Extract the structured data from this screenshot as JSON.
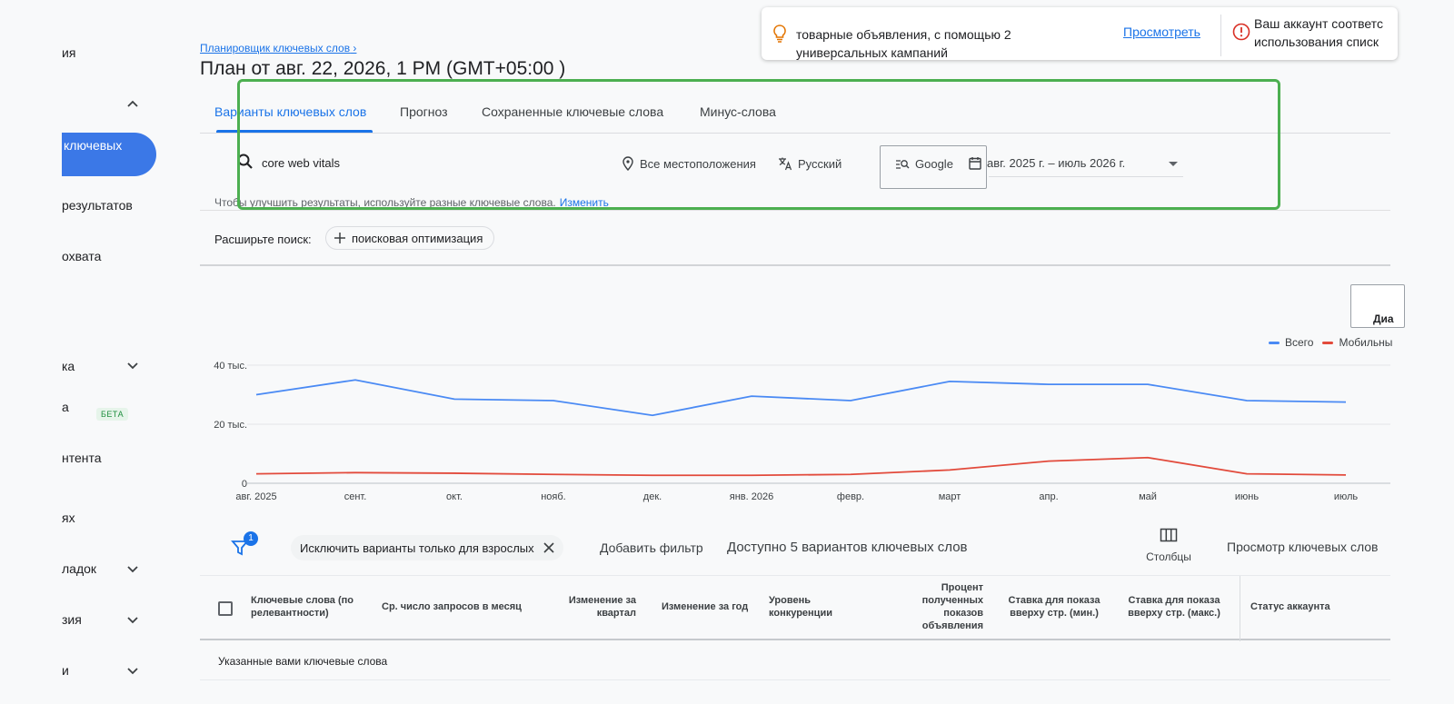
{
  "sidebar": {
    "items": [
      {
        "label": "ия"
      },
      {
        "label": "ключевых"
      },
      {
        "label": "результатов"
      },
      {
        "label": "охвата"
      },
      {
        "label": "ка"
      },
      {
        "label": "а"
      },
      {
        "label": "нтента"
      },
      {
        "label": "ях"
      },
      {
        "label": "ладок"
      },
      {
        "label": "зия"
      },
      {
        "label": "и"
      }
    ],
    "beta_label": "БЕТА"
  },
  "header": {
    "breadcrumb": "Планировщик ключевых слов",
    "title": "План от авг. 22, 2026, 1 PM (GMT+05:00 )"
  },
  "notification": {
    "text_line1": "товарные объявления, с помощью 2",
    "text_line2": "универсальных кампаний",
    "link": "Просмотреть",
    "text2_line1": "Ваш аккаунт соответс",
    "text2_line2": "использования списк"
  },
  "tabs": [
    {
      "label": "Варианты ключевых слов"
    },
    {
      "label": "Прогноз"
    },
    {
      "label": "Сохраненные ключевые слова"
    },
    {
      "label": "Минус-слова"
    }
  ],
  "search": {
    "value": "core web vitals",
    "location": "Все местоположения",
    "language": "Русский",
    "network": "Google",
    "date_range": "авг. 2025 г. – июль 2026 г.",
    "hint": "Чтобы улучшить результаты, используйте разные ключевые слова.",
    "hint_link": "Изменить"
  },
  "expand": {
    "label": "Расширьте поиск:",
    "chip": "поисковая оптимизация"
  },
  "chart_button": "Диа",
  "chart_data": {
    "type": "line",
    "x": [
      "авг. 2025",
      "сент.",
      "окт.",
      "нояб.",
      "дек.",
      "янв. 2026",
      "февр.",
      "март",
      "апр.",
      "май",
      "июнь",
      "июль"
    ],
    "y_ticks": [
      "0",
      "20 тыс.",
      "40 тыс."
    ],
    "ylim": [
      0,
      40000
    ],
    "series": [
      {
        "name": "Всего",
        "color": "#4a8af4",
        "values": [
          30000,
          35000,
          28500,
          28000,
          23000,
          29500,
          28000,
          34500,
          33500,
          33500,
          28000,
          27500
        ]
      },
      {
        "name": "Мобильны",
        "color": "#e24a3b",
        "values": [
          3200,
          3600,
          3400,
          3000,
          2700,
          2700,
          3000,
          4500,
          7500,
          8700,
          3200,
          2800
        ]
      }
    ],
    "grid": true,
    "legend": "top-right"
  },
  "filters": {
    "count": "1",
    "exclude_chip": "Исключить варианты только для взрослых",
    "add_filter": "Добавить фильтр",
    "available": "Доступно 5 вариантов ключевых слов",
    "columns": "Столбцы",
    "view": "Просмотр ключевых слов"
  },
  "table": {
    "headers": [
      "Ключевые слова (по релевантности)",
      "Ср. число запросов в месяц",
      "Изменение за квартал",
      "Изменение за год",
      "Уровень конкуренции",
      "Процент полученных показов объявления",
      "Ставка для показа вверху стр. (мин.)",
      "Ставка для показа вверху стр. (макс.)",
      "Статус аккаунта"
    ],
    "row_label": "Указанные вами ключевые слова"
  }
}
